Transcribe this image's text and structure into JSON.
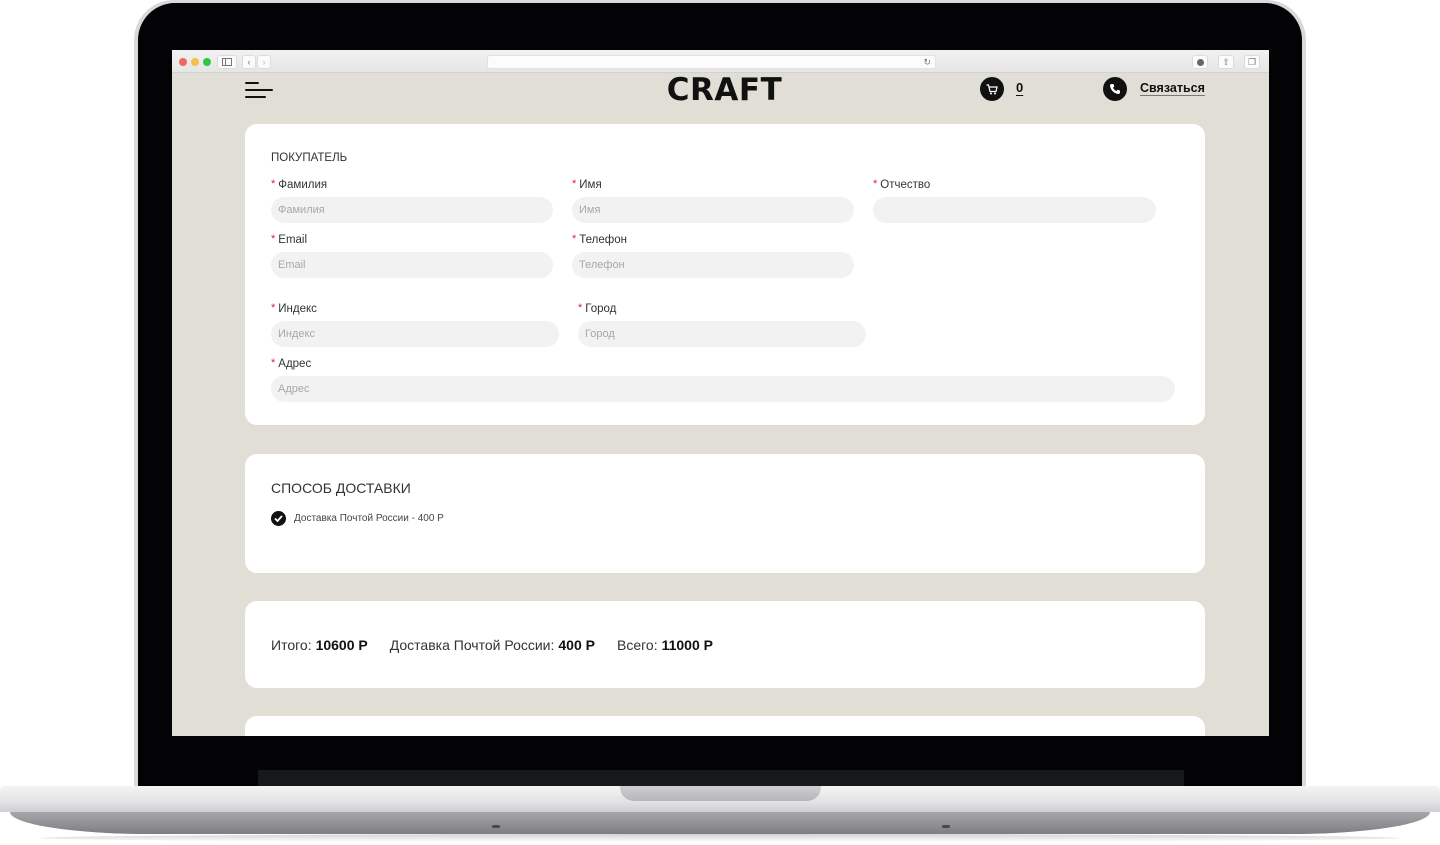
{
  "browser": {
    "address_value": "",
    "traffic_colors": {
      "close": "#ec6a5e",
      "minimize": "#f4bf4f",
      "maximize": "#2cc840"
    }
  },
  "header": {
    "logo": "CRAFT",
    "cart_count": "0",
    "contact_label": "Связаться"
  },
  "buyer": {
    "title": "ПОКУПАТЕЛЬ",
    "required_mark": "*",
    "fields": [
      {
        "label": "Фамилия",
        "placeholder": "Фамилия",
        "value": ""
      },
      {
        "label": "Имя",
        "placeholder": "Имя",
        "value": ""
      },
      {
        "label": "Отчество",
        "placeholder": "",
        "value": ""
      },
      {
        "label": "Email",
        "placeholder": "Email",
        "value": ""
      },
      {
        "label": "Телефон",
        "placeholder": "Телефон",
        "value": ""
      },
      {
        "label": "Индекс",
        "placeholder": "Индекс",
        "value": ""
      },
      {
        "label": "Город",
        "placeholder": "Город",
        "value": ""
      },
      {
        "label": "Адрес",
        "placeholder": "Адрес",
        "value": ""
      }
    ]
  },
  "delivery": {
    "title": "СПОСОБ ДОСТАВКИ",
    "options": [
      {
        "label": "Доставка Почтой России - 400 Р",
        "selected": true
      }
    ]
  },
  "totals": {
    "subtotal_label": "Итого:",
    "subtotal_value": "10600 Р",
    "shipping_label": "Доставка Почтой России:",
    "shipping_value": "400 Р",
    "total_label": "Всего:",
    "total_value": "11000 Р"
  },
  "colors": {
    "page_bg": "#e1ded5",
    "card_bg": "#ffffff",
    "input_bg": "#f2f2f2",
    "required": "#e0212b",
    "accent": "#111111"
  }
}
